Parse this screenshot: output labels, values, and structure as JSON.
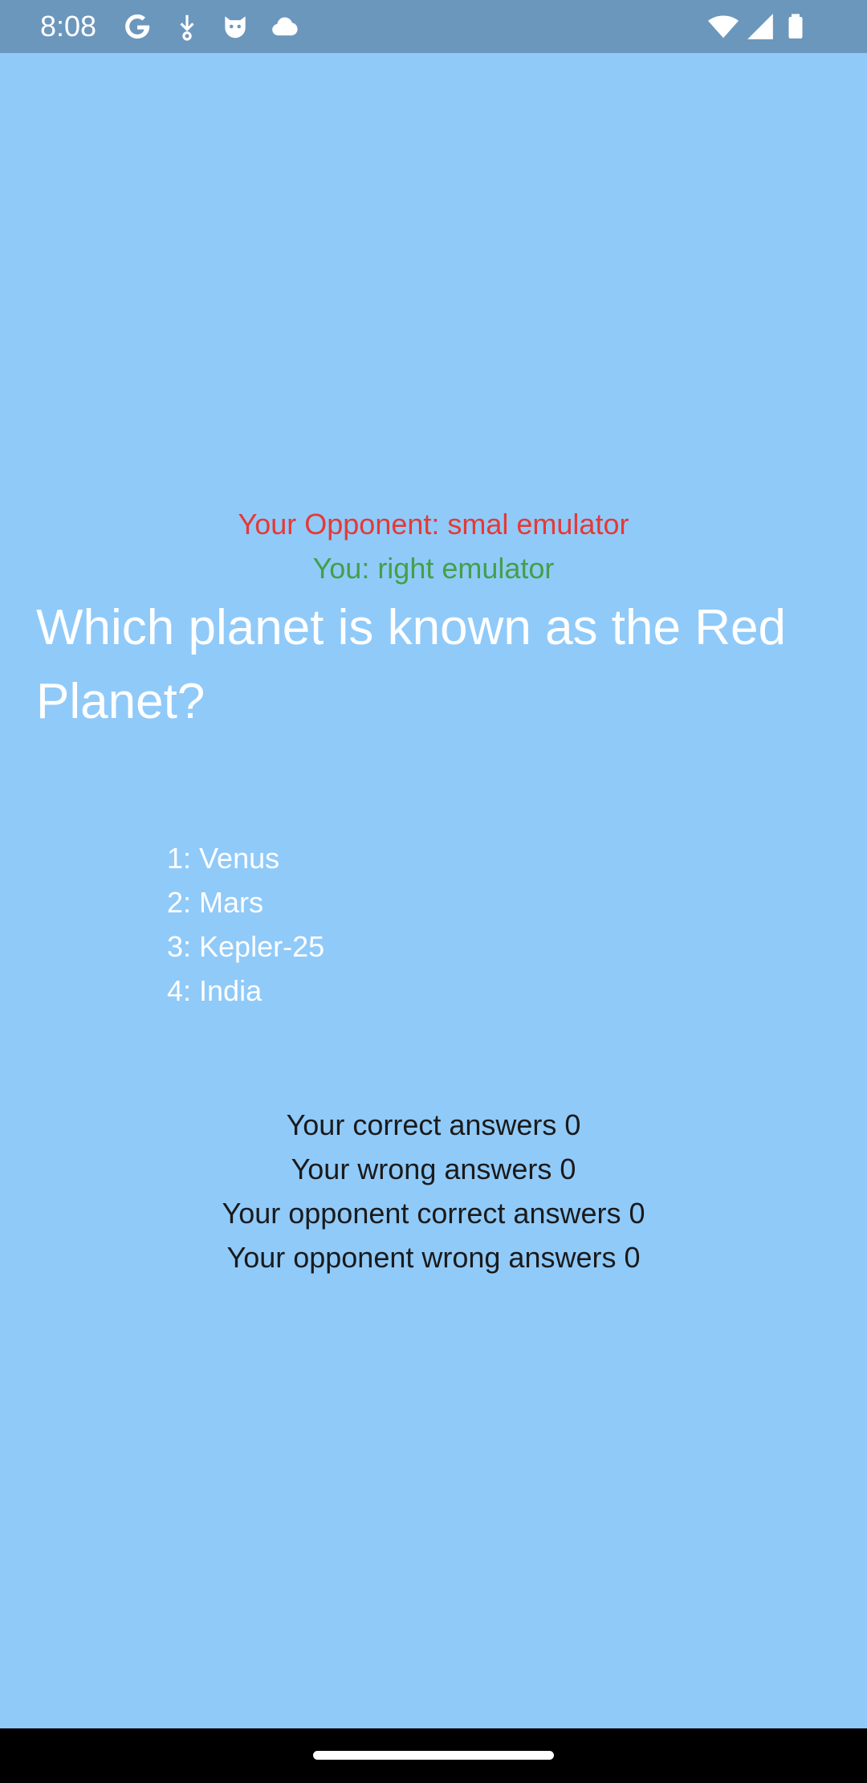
{
  "status_bar": {
    "time": "8:08",
    "left_icons": [
      "google-icon",
      "download-icon",
      "cat-icon",
      "cloud-icon"
    ],
    "right_icons": [
      "wifi-icon",
      "signal-icon",
      "battery-icon"
    ]
  },
  "game": {
    "opponent_label": "Your Opponent: smal emulator",
    "you_label": "You: right emulator",
    "question": "Which planet is known as the Red Planet?",
    "answers": [
      "1: Venus",
      "2: Mars",
      "3: Kepler-25",
      "4: India"
    ],
    "scores": [
      "Your correct answers 0",
      "Your wrong answers 0",
      "Your opponent correct answers 0",
      "Your opponent wrong answers 0"
    ]
  },
  "colors": {
    "background": "#90caf9",
    "status_bar": "#6b97bc",
    "opponent": "#e53935",
    "you": "#43a047"
  }
}
